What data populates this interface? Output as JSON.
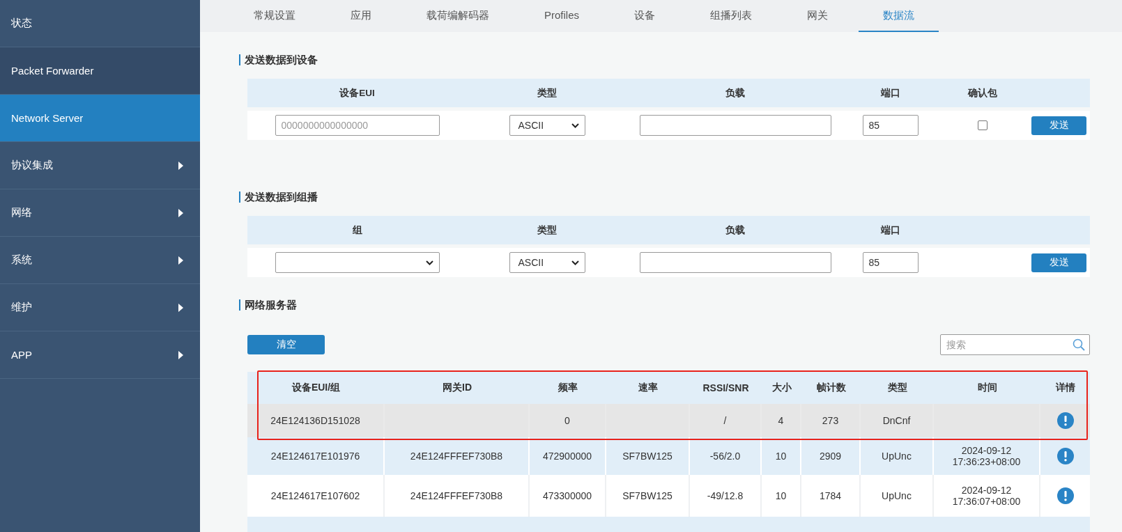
{
  "sidebar": {
    "items": [
      {
        "label": "状态",
        "selected": false,
        "has_submenu": false
      },
      {
        "label": "Packet Forwarder",
        "selected": false,
        "has_submenu": false
      },
      {
        "label": "Network Server",
        "selected": true,
        "has_submenu": false
      },
      {
        "label": "协议集成",
        "selected": false,
        "has_submenu": true
      },
      {
        "label": "网络",
        "selected": false,
        "has_submenu": true
      },
      {
        "label": "系统",
        "selected": false,
        "has_submenu": true
      },
      {
        "label": "维护",
        "selected": false,
        "has_submenu": true
      },
      {
        "label": "APP",
        "selected": false,
        "has_submenu": true
      }
    ]
  },
  "tabs": [
    {
      "label": "常规设置",
      "selected": false
    },
    {
      "label": "应用",
      "selected": false
    },
    {
      "label": "载荷编解码器",
      "selected": false
    },
    {
      "label": "Profiles",
      "selected": false
    },
    {
      "label": "设备",
      "selected": false
    },
    {
      "label": "组播列表",
      "selected": false
    },
    {
      "label": "网关",
      "selected": false
    },
    {
      "label": "数据流",
      "selected": true
    }
  ],
  "send_to_device": {
    "title": "发送数据到设备",
    "columns": [
      "设备EUI",
      "类型",
      "负载",
      "端口",
      "确认包"
    ],
    "device_eui": {
      "placeholder": "0000000000000000"
    },
    "type": {
      "value": "ASCII"
    },
    "port": {
      "value": "85"
    },
    "confirmed": {
      "checked": false
    },
    "send_button": "发送"
  },
  "send_to_multicast": {
    "title": "发送数据到组播",
    "columns": [
      "组",
      "类型",
      "负载",
      "端口"
    ],
    "type": {
      "value": "ASCII"
    },
    "port": {
      "value": "85"
    },
    "send_button": "发送"
  },
  "network_server": {
    "title": "网络服务器",
    "clear_button": "清空",
    "search": {
      "placeholder": "搜索"
    },
    "table": {
      "columns": [
        "设备EUI/组",
        "网关ID",
        "频率",
        "速率",
        "RSSI/SNR",
        "大小",
        "帧计数",
        "类型",
        "时间",
        "详情"
      ],
      "rows": [
        {
          "highlighted": true,
          "eui": "24E124136D151028",
          "frequency": "0",
          "rssi_snr": "/",
          "size": "4",
          "frame_count": "273",
          "type": "DnCnf"
        },
        {
          "highlighted": false,
          "eui": "24E124617E101976",
          "gateway_id": "24E124FFFEF730B8",
          "frequency": "472900000",
          "rate": "SF7BW125",
          "rssi_snr": "-56/2.0",
          "size": "10",
          "frame_count": "2909",
          "type": "UpUnc",
          "time": "2024-09-12 17:36:23+08:00"
        },
        {
          "highlighted": false,
          "eui": "24E124617E107602",
          "gateway_id": "24E124FFFEF730B8",
          "frequency": "473300000",
          "rate": "SF7BW125",
          "rssi_snr": "-49/12.8",
          "size": "10",
          "frame_count": "1784",
          "type": "UpUnc",
          "time": "2024-09-12 17:36:07+08:00"
        }
      ]
    }
  }
}
